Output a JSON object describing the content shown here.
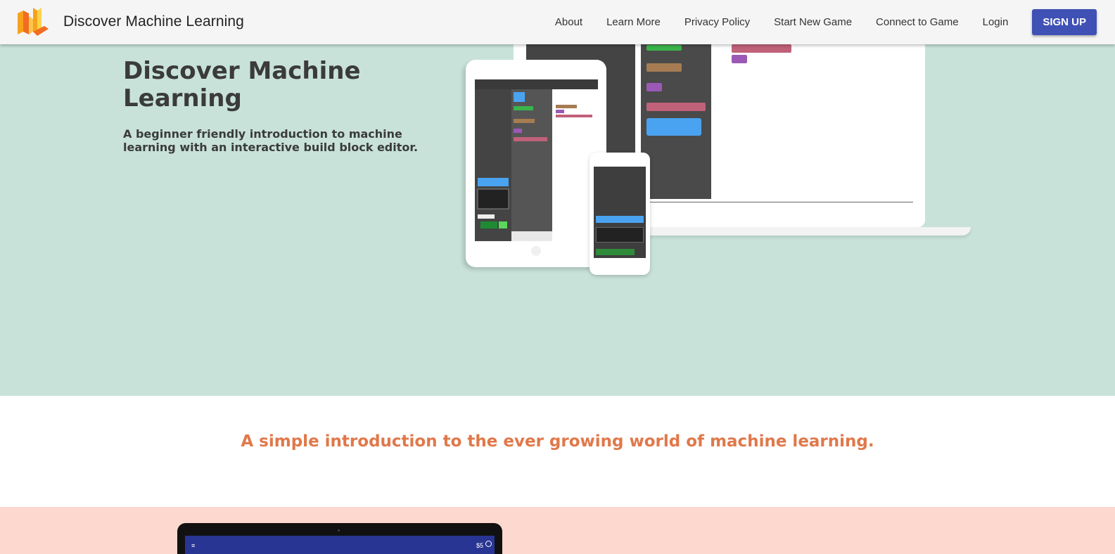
{
  "navbar": {
    "brand": "Discover Machine Learning",
    "links": [
      "About",
      "Learn More",
      "Privacy Policy",
      "Start New Game",
      "Connect to Game",
      "Login"
    ],
    "signup_label": "SIGN UP"
  },
  "hero": {
    "title": "Discover Machine Learning",
    "subtitle": "A beginner friendly introduction to machine learning with an interactive build block editor."
  },
  "intro": {
    "text": "A simple introduction to the ever growing world of machine learning."
  },
  "device": {
    "menu_icon": "≡",
    "coins": "$5"
  },
  "colors": {
    "hero_bg": "#c8e2da",
    "accent": "#3f51b5",
    "intro_text": "#e0784a",
    "pink_bg": "#fdd8cf"
  }
}
